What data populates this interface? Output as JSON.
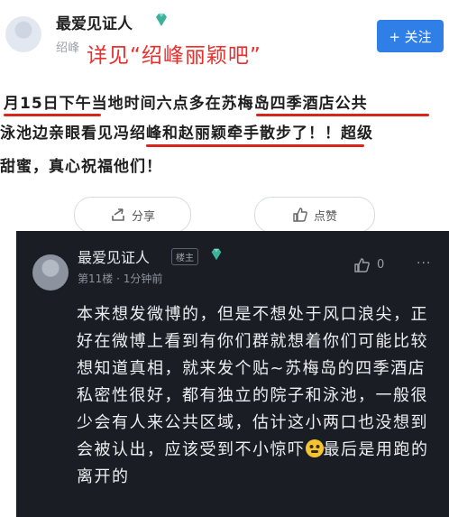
{
  "post": {
    "username": "最爱见证人",
    "meta_partial": "绍峰",
    "follow_label": "+ 关注",
    "overlay_caption": "详见“绍峰丽颖吧”",
    "line1": "月15日下午当地时间六点多在苏梅岛四季酒店公共",
    "line2": "泳池边亲眼看见冯绍峰和赵丽颖牵手散步了！！超级",
    "line3": "甜蜜，真心祝福他们！",
    "share_label": "分享",
    "like_label": "点赞"
  },
  "comment": {
    "username": "最爱见证人",
    "badge": "楼主",
    "floor_time": "第11楼 · 1分钟前",
    "like_count": "0",
    "more": "···",
    "body": "本来想发微博的，但是不想处于风口浪尖，正好在微博上看到有你们群就想着你们可能比较想知道真相，就来发个贴~苏梅岛的四季酒店私密性很好，都有独立的院子和泳池，一般很少会有人来公共区域，估计这小两口也没想到会被认出，应该受到不小惊吓",
    "body_tail": "最后是用跑的离开的"
  },
  "colors": {
    "accent_blue": "#2f7fe6",
    "highlight_red": "#d9261c",
    "dark_bg": "#1a1d24",
    "vip_green": "#3bb39a"
  }
}
